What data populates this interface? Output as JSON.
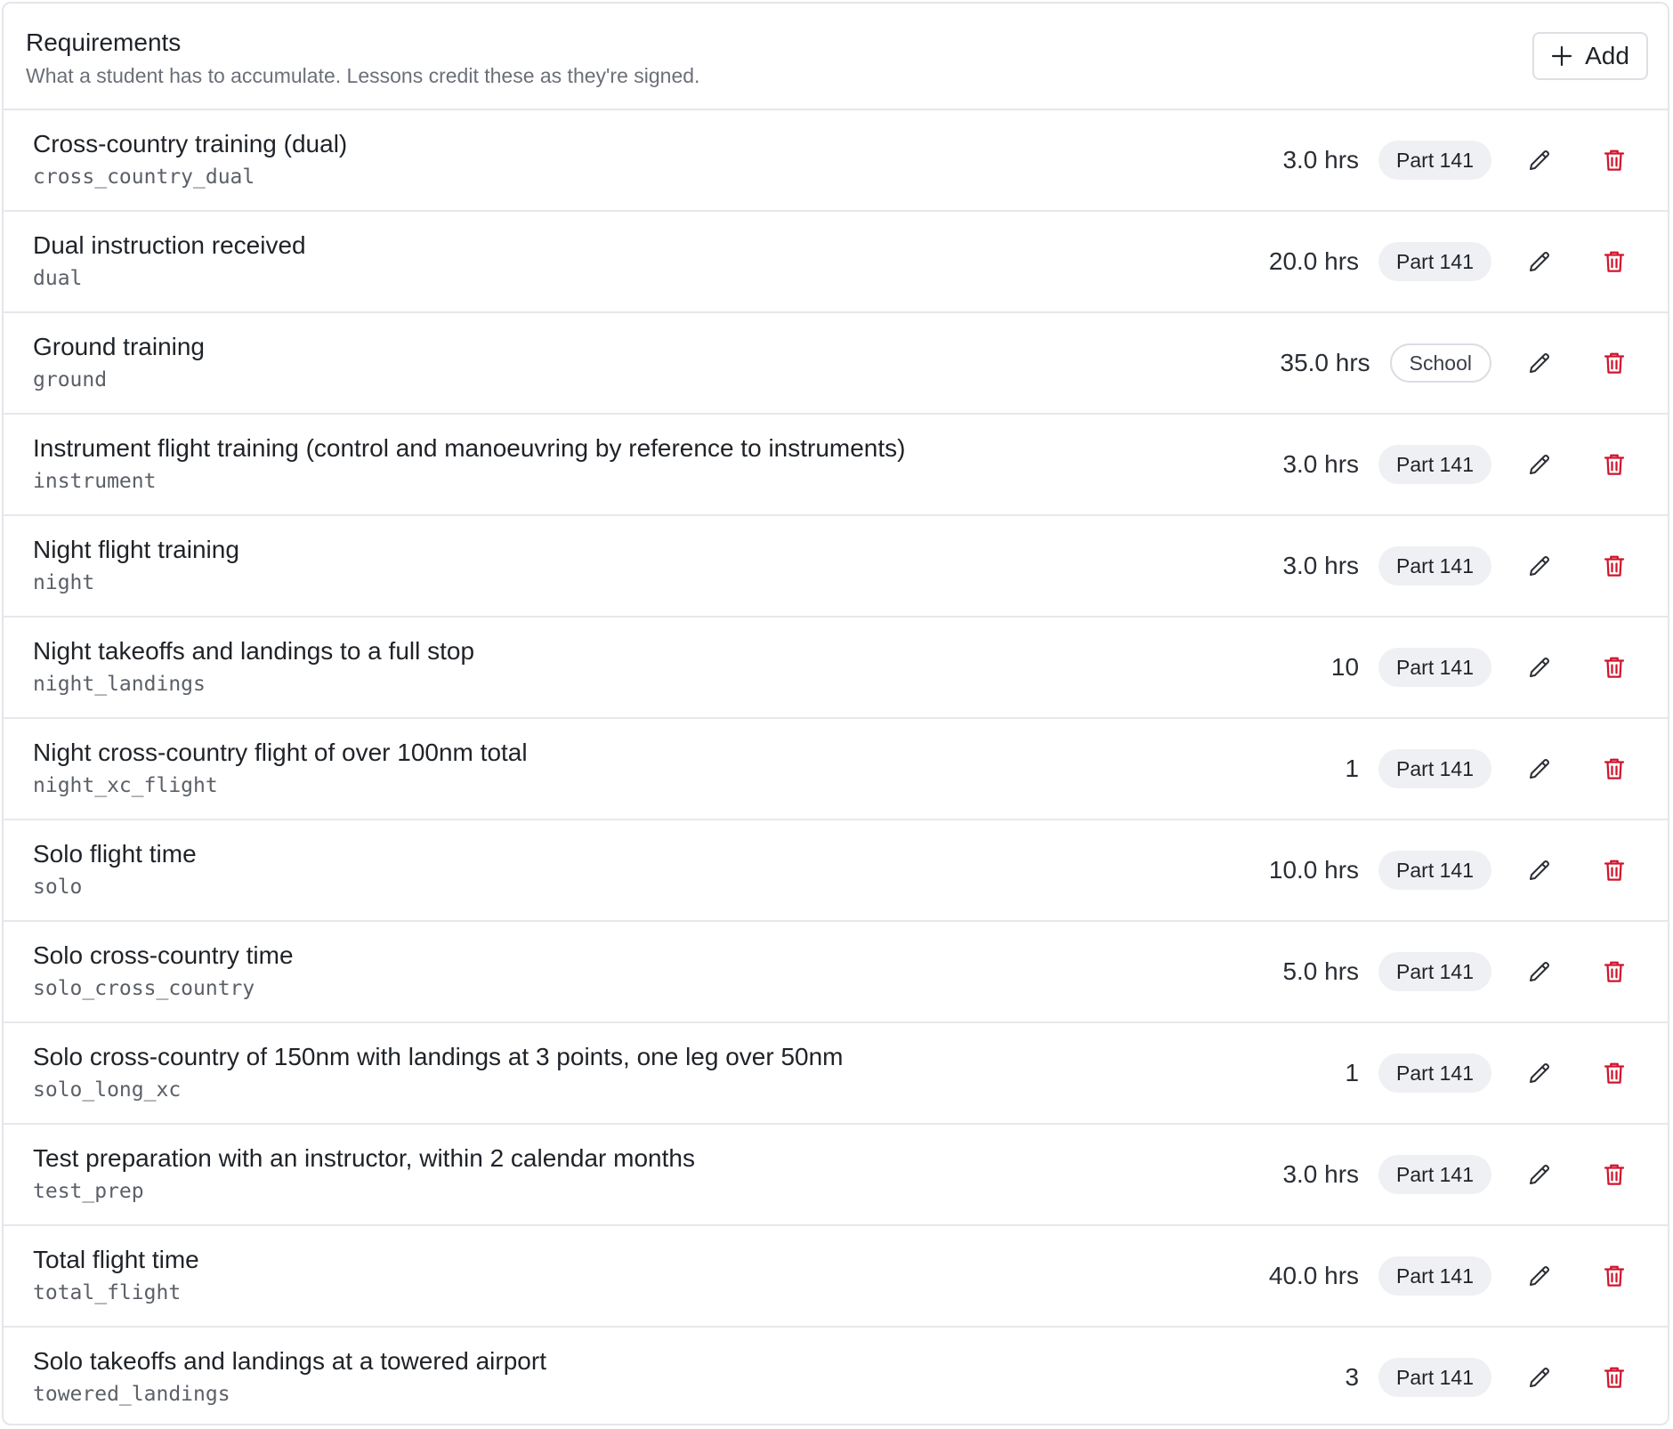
{
  "header": {
    "title": "Requirements",
    "subtitle": "What a student has to accumulate. Lessons credit these as they're signed.",
    "add_label": "Add",
    "add_icon": "plus-icon"
  },
  "colors": {
    "delete_icon": "#d0142c",
    "badge_fill": "#eff0f3",
    "border": "#e4e6ea"
  },
  "rows": [
    {
      "title": "Cross-country training (dual)",
      "key": "cross_country_dual",
      "value": "3.0 hrs",
      "badge": "Part 141",
      "badge_style": "filled"
    },
    {
      "title": "Dual instruction received",
      "key": "dual",
      "value": "20.0 hrs",
      "badge": "Part 141",
      "badge_style": "filled"
    },
    {
      "title": "Ground training",
      "key": "ground",
      "value": "35.0 hrs",
      "badge": "School",
      "badge_style": "outline"
    },
    {
      "title": "Instrument flight training (control and manoeuvring by reference to instruments)",
      "key": "instrument",
      "value": "3.0 hrs",
      "badge": "Part 141",
      "badge_style": "filled"
    },
    {
      "title": "Night flight training",
      "key": "night",
      "value": "3.0 hrs",
      "badge": "Part 141",
      "badge_style": "filled"
    },
    {
      "title": "Night takeoffs and landings to a full stop",
      "key": "night_landings",
      "value": "10",
      "badge": "Part 141",
      "badge_style": "filled"
    },
    {
      "title": "Night cross-country flight of over 100nm total",
      "key": "night_xc_flight",
      "value": "1",
      "badge": "Part 141",
      "badge_style": "filled"
    },
    {
      "title": "Solo flight time",
      "key": "solo",
      "value": "10.0 hrs",
      "badge": "Part 141",
      "badge_style": "filled"
    },
    {
      "title": "Solo cross-country time",
      "key": "solo_cross_country",
      "value": "5.0 hrs",
      "badge": "Part 141",
      "badge_style": "filled"
    },
    {
      "title": "Solo cross-country of 150nm with landings at 3 points, one leg over 50nm",
      "key": "solo_long_xc",
      "value": "1",
      "badge": "Part 141",
      "badge_style": "filled"
    },
    {
      "title": "Test preparation with an instructor, within 2 calendar months",
      "key": "test_prep",
      "value": "3.0 hrs",
      "badge": "Part 141",
      "badge_style": "filled"
    },
    {
      "title": "Total flight time",
      "key": "total_flight",
      "value": "40.0 hrs",
      "badge": "Part 141",
      "badge_style": "filled"
    },
    {
      "title": "Solo takeoffs and landings at a towered airport",
      "key": "towered_landings",
      "value": "3",
      "badge": "Part 141",
      "badge_style": "filled"
    }
  ]
}
